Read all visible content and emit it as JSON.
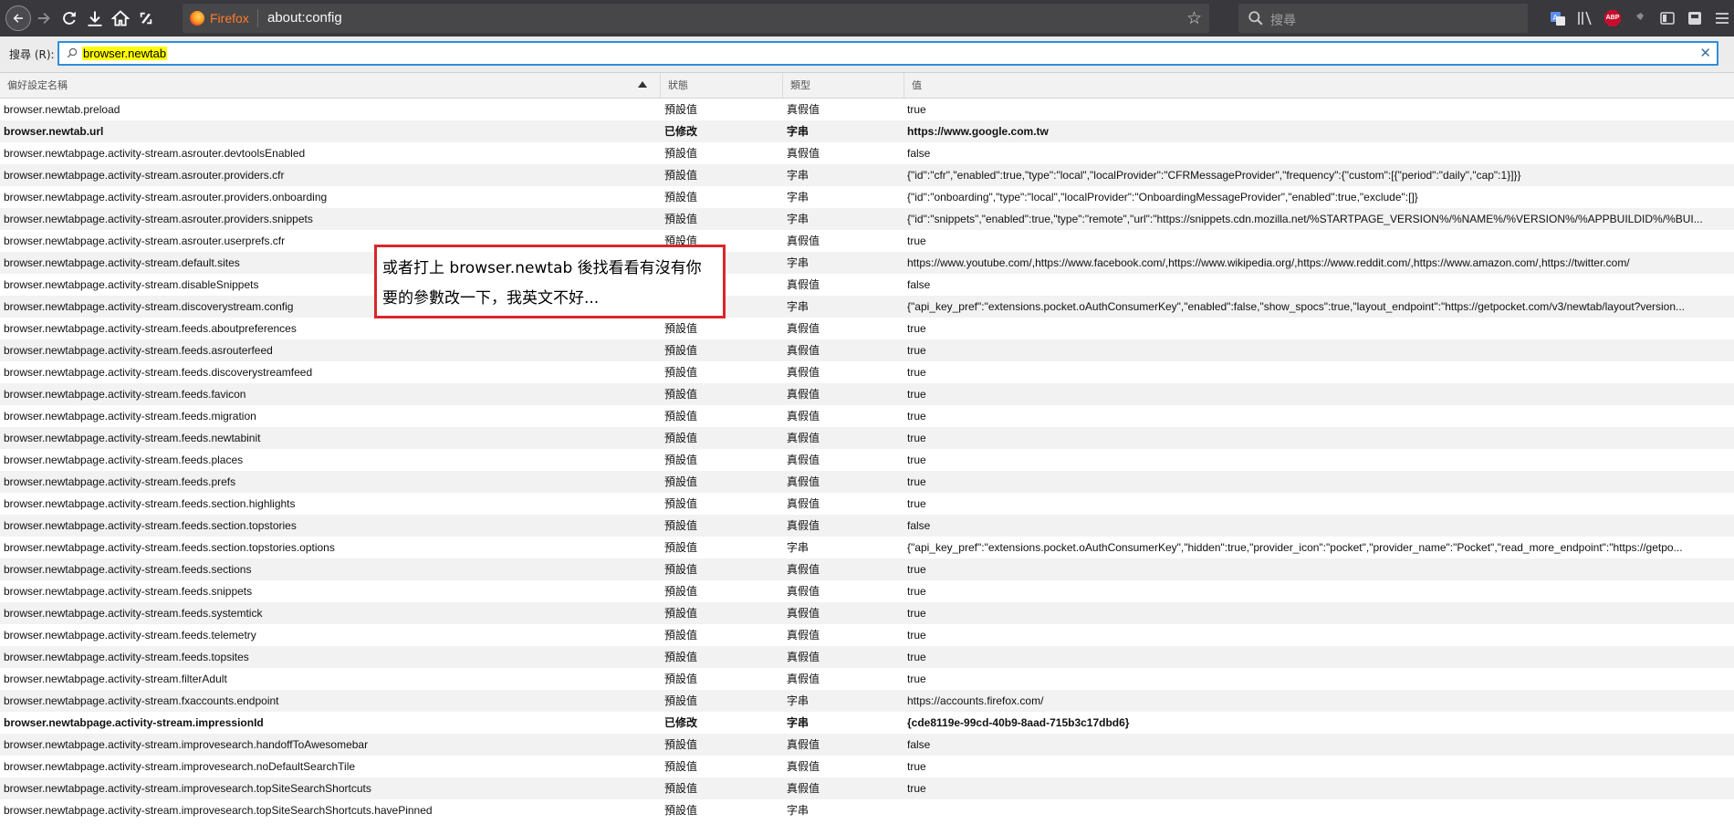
{
  "browser": {
    "identity_label": "Firefox",
    "url": "about:config",
    "search_placeholder": "搜尋",
    "abp_label": "ABP"
  },
  "config_search": {
    "label": "搜尋 (R):",
    "value": "browser.newtab"
  },
  "columns": {
    "name": "偏好設定名稱",
    "status": "狀態",
    "type": "類型",
    "value": "值"
  },
  "rows": [
    {
      "name": "browser.newtab.preload",
      "status": "預設值",
      "type": "真假值",
      "value": "true"
    },
    {
      "name": "browser.newtab.url",
      "status": "已修改",
      "type": "字串",
      "value": "https://www.google.com.tw"
    },
    {
      "name": "browser.newtabpage.activity-stream.asrouter.devtoolsEnabled",
      "status": "預設值",
      "type": "真假值",
      "value": "false"
    },
    {
      "name": "browser.newtabpage.activity-stream.asrouter.providers.cfr",
      "status": "預設值",
      "type": "字串",
      "value": "{\"id\":\"cfr\",\"enabled\":true,\"type\":\"local\",\"localProvider\":\"CFRMessageProvider\",\"frequency\":{\"custom\":[{\"period\":\"daily\",\"cap\":1}]}}"
    },
    {
      "name": "browser.newtabpage.activity-stream.asrouter.providers.onboarding",
      "status": "預設值",
      "type": "字串",
      "value": "{\"id\":\"onboarding\",\"type\":\"local\",\"localProvider\":\"OnboardingMessageProvider\",\"enabled\":true,\"exclude\":[]}"
    },
    {
      "name": "browser.newtabpage.activity-stream.asrouter.providers.snippets",
      "status": "預設值",
      "type": "字串",
      "value": "{\"id\":\"snippets\",\"enabled\":true,\"type\":\"remote\",\"url\":\"https://snippets.cdn.mozilla.net/%STARTPAGE_VERSION%/%NAME%/%VERSION%/%APPBUILDID%/%BUI..."
    },
    {
      "name": "browser.newtabpage.activity-stream.asrouter.userprefs.cfr",
      "status": "預設值",
      "type": "真假值",
      "value": "true"
    },
    {
      "name": "browser.newtabpage.activity-stream.default.sites",
      "status": "",
      "type": "字串",
      "value": "https://www.youtube.com/,https://www.facebook.com/,https://www.wikipedia.org/,https://www.reddit.com/,https://www.amazon.com/,https://twitter.com/"
    },
    {
      "name": "browser.newtabpage.activity-stream.disableSnippets",
      "status": "",
      "type": "真假值",
      "value": "false"
    },
    {
      "name": "browser.newtabpage.activity-stream.discoverystream.config",
      "status": "",
      "type": "字串",
      "value": "{\"api_key_pref\":\"extensions.pocket.oAuthConsumerKey\",\"enabled\":false,\"show_spocs\":true,\"layout_endpoint\":\"https://getpocket.com/v3/newtab/layout?version..."
    },
    {
      "name": "browser.newtabpage.activity-stream.feeds.aboutpreferences",
      "status": "預設值",
      "type": "真假值",
      "value": "true"
    },
    {
      "name": "browser.newtabpage.activity-stream.feeds.asrouterfeed",
      "status": "預設值",
      "type": "真假值",
      "value": "true"
    },
    {
      "name": "browser.newtabpage.activity-stream.feeds.discoverystreamfeed",
      "status": "預設值",
      "type": "真假值",
      "value": "true"
    },
    {
      "name": "browser.newtabpage.activity-stream.feeds.favicon",
      "status": "預設值",
      "type": "真假值",
      "value": "true"
    },
    {
      "name": "browser.newtabpage.activity-stream.feeds.migration",
      "status": "預設值",
      "type": "真假值",
      "value": "true"
    },
    {
      "name": "browser.newtabpage.activity-stream.feeds.newtabinit",
      "status": "預設值",
      "type": "真假值",
      "value": "true"
    },
    {
      "name": "browser.newtabpage.activity-stream.feeds.places",
      "status": "預設值",
      "type": "真假值",
      "value": "true"
    },
    {
      "name": "browser.newtabpage.activity-stream.feeds.prefs",
      "status": "預設值",
      "type": "真假值",
      "value": "true"
    },
    {
      "name": "browser.newtabpage.activity-stream.feeds.section.highlights",
      "status": "預設值",
      "type": "真假值",
      "value": "true"
    },
    {
      "name": "browser.newtabpage.activity-stream.feeds.section.topstories",
      "status": "預設值",
      "type": "真假值",
      "value": "false"
    },
    {
      "name": "browser.newtabpage.activity-stream.feeds.section.topstories.options",
      "status": "預設值",
      "type": "字串",
      "value": "{\"api_key_pref\":\"extensions.pocket.oAuthConsumerKey\",\"hidden\":true,\"provider_icon\":\"pocket\",\"provider_name\":\"Pocket\",\"read_more_endpoint\":\"https://getpo..."
    },
    {
      "name": "browser.newtabpage.activity-stream.feeds.sections",
      "status": "預設值",
      "type": "真假值",
      "value": "true"
    },
    {
      "name": "browser.newtabpage.activity-stream.feeds.snippets",
      "status": "預設值",
      "type": "真假值",
      "value": "true"
    },
    {
      "name": "browser.newtabpage.activity-stream.feeds.systemtick",
      "status": "預設值",
      "type": "真假值",
      "value": "true"
    },
    {
      "name": "browser.newtabpage.activity-stream.feeds.telemetry",
      "status": "預設值",
      "type": "真假值",
      "value": "true"
    },
    {
      "name": "browser.newtabpage.activity-stream.feeds.topsites",
      "status": "預設值",
      "type": "真假值",
      "value": "true"
    },
    {
      "name": "browser.newtabpage.activity-stream.filterAdult",
      "status": "預設值",
      "type": "真假值",
      "value": "true"
    },
    {
      "name": "browser.newtabpage.activity-stream.fxaccounts.endpoint",
      "status": "預設值",
      "type": "字串",
      "value": "https://accounts.firefox.com/"
    },
    {
      "name": "browser.newtabpage.activity-stream.impressionId",
      "status": "已修改",
      "type": "字串",
      "value": "{cde8119e-99cd-40b9-8aad-715b3c17dbd6}"
    },
    {
      "name": "browser.newtabpage.activity-stream.improvesearch.handoffToAwesomebar",
      "status": "預設值",
      "type": "真假值",
      "value": "false"
    },
    {
      "name": "browser.newtabpage.activity-stream.improvesearch.noDefaultSearchTile",
      "status": "預設值",
      "type": "真假值",
      "value": "true"
    },
    {
      "name": "browser.newtabpage.activity-stream.improvesearch.topSiteSearchShortcuts",
      "status": "預設值",
      "type": "真假值",
      "value": "true"
    },
    {
      "name": "browser.newtabpage.activity-stream.improvesearch.topSiteSearchShortcuts.havePinned",
      "status": "預設值",
      "type": "字串",
      "value": ""
    }
  ],
  "annotation": {
    "line1": "或者打上 browser.newtab 後找看看有沒有你",
    "line2": "要的參數改一下，我英文不好..."
  },
  "colors": {
    "toolbar_bg": "#38383d",
    "search_highlight": "#ffff00",
    "annotation_border": "#d9262a",
    "focus_ring": "#2f8edb"
  },
  "icons": [
    "back-icon",
    "forward-icon",
    "reload-icon",
    "download-icon",
    "home-icon",
    "screenshot-icon",
    "firefox-logo-icon",
    "star-icon",
    "search-icon",
    "translate-icon",
    "library-icon",
    "abp-icon",
    "puzzle-icon",
    "sidebar-icon",
    "sync-icon",
    "menu-icon",
    "clear-icon"
  ]
}
